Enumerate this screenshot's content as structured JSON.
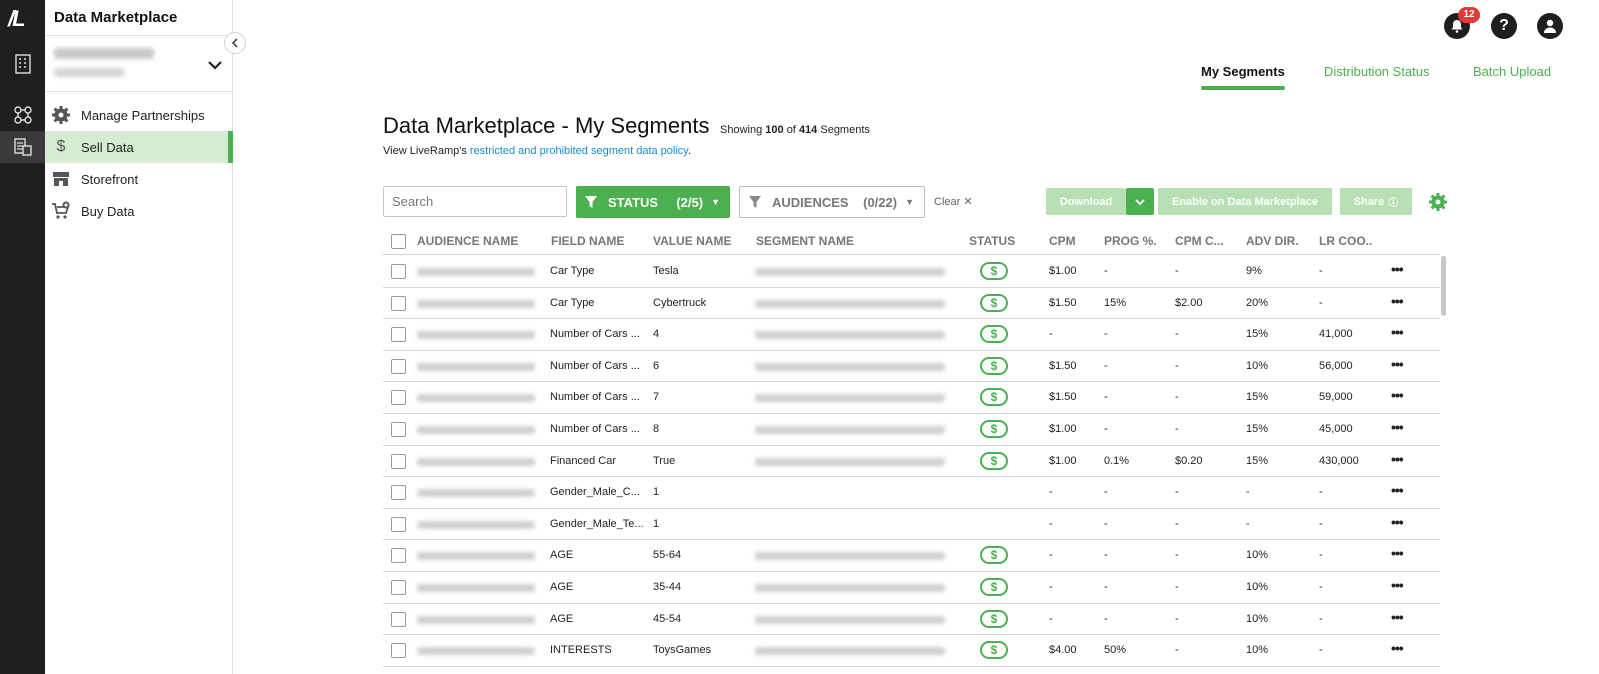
{
  "app": {
    "title": "Data Marketplace",
    "logo_text": "/L"
  },
  "notifications": {
    "count": "12"
  },
  "tabs": [
    {
      "label": "My Segments",
      "active": true
    },
    {
      "label": "Distribution Status",
      "active": false
    },
    {
      "label": "Batch Upload",
      "active": false
    }
  ],
  "sidebar": {
    "items": [
      {
        "label": "Manage Partnerships",
        "icon": "gear-icon"
      },
      {
        "label": "Sell Data",
        "icon": "dollar-icon",
        "active": true
      },
      {
        "label": "Storefront",
        "icon": "storefront-icon"
      },
      {
        "label": "Buy Data",
        "icon": "cart-icon"
      }
    ]
  },
  "page": {
    "title": "Data Marketplace - My Segments",
    "showing_prefix": "Showing",
    "showing_count": "100",
    "showing_of": "of",
    "showing_total": "414",
    "showing_suffix": "Segments",
    "policy_prefix": "View LiveRamp's",
    "policy_link": "restricted and prohibited segment data policy",
    "policy_suffix": "."
  },
  "toolbar": {
    "search_placeholder": "Search",
    "status_filter": {
      "label": "STATUS",
      "count": "(2/5)"
    },
    "audiences_filter": {
      "label": "AUDIENCES",
      "count": "(0/22)"
    },
    "clear_label": "Clear",
    "download_label": "Download",
    "enable_label": "Enable on Data Marketplace",
    "share_label": "Share"
  },
  "colors": {
    "accent": "#4caf50",
    "accent_light": "#b8e0b4",
    "link": "#1a8bd1",
    "badge": "#e53935"
  },
  "table": {
    "columns": [
      "AUDIENCE NAME",
      "FIELD NAME",
      "VALUE NAME",
      "SEGMENT NAME",
      "STATUS",
      "CPM",
      "PROG %.",
      "CPM C...",
      "ADV DIR.",
      "LR COO.."
    ],
    "rows": [
      {
        "field": "Car Type",
        "value": "Tesla",
        "has_segment": true,
        "status": "$",
        "cpm": "$1.00",
        "prog": "-",
        "cpmc": "-",
        "adv": "9%",
        "lr": "-"
      },
      {
        "field": "Car Type",
        "value": "Cybertruck",
        "has_segment": true,
        "status": "$",
        "cpm": "$1.50",
        "prog": "15%",
        "cpmc": "$2.00",
        "adv": "20%",
        "lr": "-"
      },
      {
        "field": "Number of Cars ...",
        "value": "4",
        "has_segment": true,
        "status": "$",
        "cpm": "-",
        "prog": "-",
        "cpmc": "-",
        "adv": "15%",
        "lr": "41,000"
      },
      {
        "field": "Number of Cars ...",
        "value": "6",
        "has_segment": true,
        "status": "$",
        "cpm": "$1.50",
        "prog": "-",
        "cpmc": "-",
        "adv": "10%",
        "lr": "56,000"
      },
      {
        "field": "Number of Cars ...",
        "value": "7",
        "has_segment": true,
        "status": "$",
        "cpm": "$1.50",
        "prog": "-",
        "cpmc": "-",
        "adv": "15%",
        "lr": "59,000"
      },
      {
        "field": "Number of Cars ...",
        "value": "8",
        "has_segment": true,
        "status": "$",
        "cpm": "$1.00",
        "prog": "-",
        "cpmc": "-",
        "adv": "15%",
        "lr": "45,000"
      },
      {
        "field": "Financed Car",
        "value": "True",
        "has_segment": true,
        "status": "$",
        "cpm": "$1.00",
        "prog": "0.1%",
        "cpmc": "$0.20",
        "adv": "15%",
        "lr": "430,000"
      },
      {
        "field": "Gender_Male_C...",
        "value": "1",
        "has_segment": false,
        "status": "",
        "cpm": "-",
        "prog": "-",
        "cpmc": "-",
        "adv": "-",
        "lr": "-"
      },
      {
        "field": "Gender_Male_Te...",
        "value": "1",
        "has_segment": false,
        "status": "",
        "cpm": "-",
        "prog": "-",
        "cpmc": "-",
        "adv": "-",
        "lr": "-"
      },
      {
        "field": "AGE",
        "value": "55-64",
        "has_segment": true,
        "status": "$",
        "cpm": "-",
        "prog": "-",
        "cpmc": "-",
        "adv": "10%",
        "lr": "-"
      },
      {
        "field": "AGE",
        "value": "35-44",
        "has_segment": true,
        "status": "$",
        "cpm": "-",
        "prog": "-",
        "cpmc": "-",
        "adv": "10%",
        "lr": "-"
      },
      {
        "field": "AGE",
        "value": "45-54",
        "has_segment": true,
        "status": "$",
        "cpm": "-",
        "prog": "-",
        "cpmc": "-",
        "adv": "10%",
        "lr": "-"
      },
      {
        "field": "INTERESTS",
        "value": "ToysGames",
        "has_segment": true,
        "status": "$",
        "cpm": "$4.00",
        "prog": "50%",
        "cpmc": "-",
        "adv": "10%",
        "lr": "-"
      }
    ],
    "more_glyph": "•••"
  }
}
